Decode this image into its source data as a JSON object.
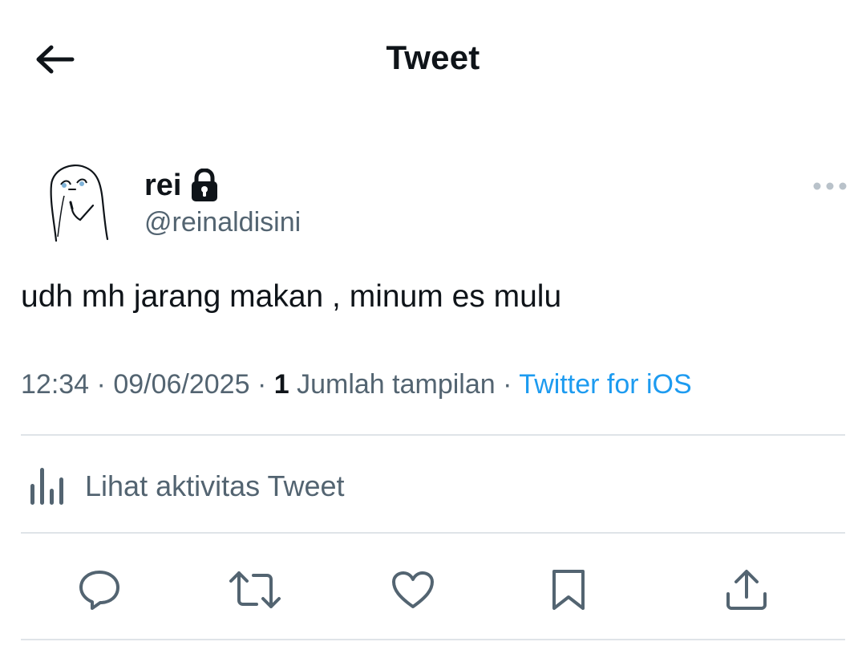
{
  "header": {
    "title": "Tweet",
    "back_icon": "arrow-left-icon"
  },
  "author": {
    "display_name": "rei",
    "handle": "@reinaldisini",
    "protected_icon": "lock-icon",
    "avatar": "avatar-doodle"
  },
  "tweet": {
    "text": "udh mh jarang makan , minum es mulu",
    "time": "12:34",
    "date": "09/06/2025",
    "views_count": "1",
    "views_label": "Jumlah tampilan",
    "separator": "·",
    "source": "Twitter for iOS"
  },
  "activity": {
    "label": "Lihat aktivitas Tweet",
    "icon": "analytics-bars-icon"
  },
  "actions": [
    {
      "name": "reply",
      "icon": "reply-bubble-icon"
    },
    {
      "name": "retweet",
      "icon": "retweet-icon"
    },
    {
      "name": "like",
      "icon": "heart-icon"
    },
    {
      "name": "bookmark",
      "icon": "bookmark-icon"
    },
    {
      "name": "share",
      "icon": "share-icon"
    }
  ],
  "colors": {
    "text_primary": "#0f1419",
    "text_secondary": "#536471",
    "accent": "#1d9bf0",
    "divider": "#dfe4e8"
  }
}
